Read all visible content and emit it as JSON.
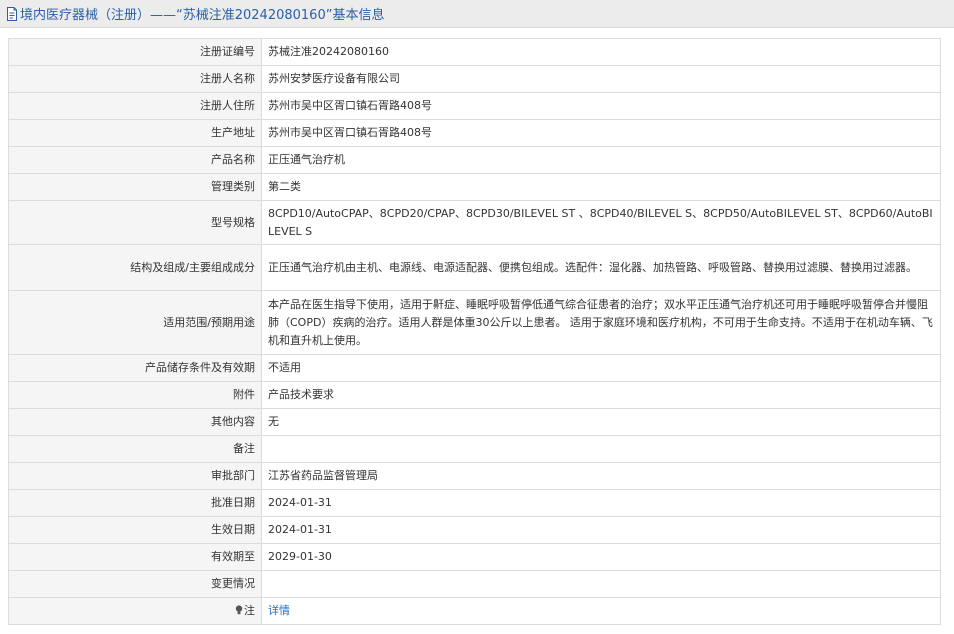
{
  "header": {
    "title": "境内医疗器械（注册）——“苏械注准20242080160”基本信息",
    "icon": "document-icon"
  },
  "rows": [
    {
      "label": "注册证编号",
      "value": "苏械注准20242080160"
    },
    {
      "label": "注册人名称",
      "value": "苏州安梦医疗设备有限公司"
    },
    {
      "label": "注册人住所",
      "value": "苏州市吴中区胥口镇石胥路408号"
    },
    {
      "label": "生产地址",
      "value": "苏州市吴中区胥口镇石胥路408号"
    },
    {
      "label": "产品名称",
      "value": "正压通气治疗机"
    },
    {
      "label": "管理类别",
      "value": "第二类"
    },
    {
      "label": "型号规格",
      "value": "8CPD10/AutoCPAP、8CPD20/CPAP、8CPD30/BILEVEL ST 、8CPD40/BILEVEL S、8CPD50/AutoBILEVEL ST、8CPD60/AutoBILEVEL S"
    },
    {
      "label": "结构及组成/主要组成成分",
      "value": "正压通气治疗机由主机、电源线、电源适配器、便携包组成。选配件：湿化器、加热管路、呼吸管路、替换用过滤膜、替换用过滤器。"
    },
    {
      "label": "适用范围/预期用途",
      "value": "本产品在医生指导下使用，适用于鼾症、睡眠呼吸暂停低通气综合征患者的治疗；双水平正压通气治疗机还可用于睡眠呼吸暂停合并慢阻肺（COPD）疾病的治疗。适用人群是体重30公斤以上患者。 适用于家庭环境和医疗机构，不可用于生命支持。不适用于在机动车辆、飞机和直升机上使用。"
    },
    {
      "label": "产品储存条件及有效期",
      "value": "不适用"
    },
    {
      "label": "附件",
      "value": "产品技术要求"
    },
    {
      "label": "其他内容",
      "value": "无"
    },
    {
      "label": "备注",
      "value": ""
    },
    {
      "label": "审批部门",
      "value": "江苏省药品监督管理局"
    },
    {
      "label": "批准日期",
      "value": "2024-01-31"
    },
    {
      "label": "生效日期",
      "value": "2024-01-31"
    },
    {
      "label": "有效期至",
      "value": "2029-01-30"
    },
    {
      "label": "变更情况",
      "value": ""
    }
  ],
  "note_row": {
    "label": "注",
    "icon": "lightbulb-icon",
    "link_text": "详情"
  }
}
